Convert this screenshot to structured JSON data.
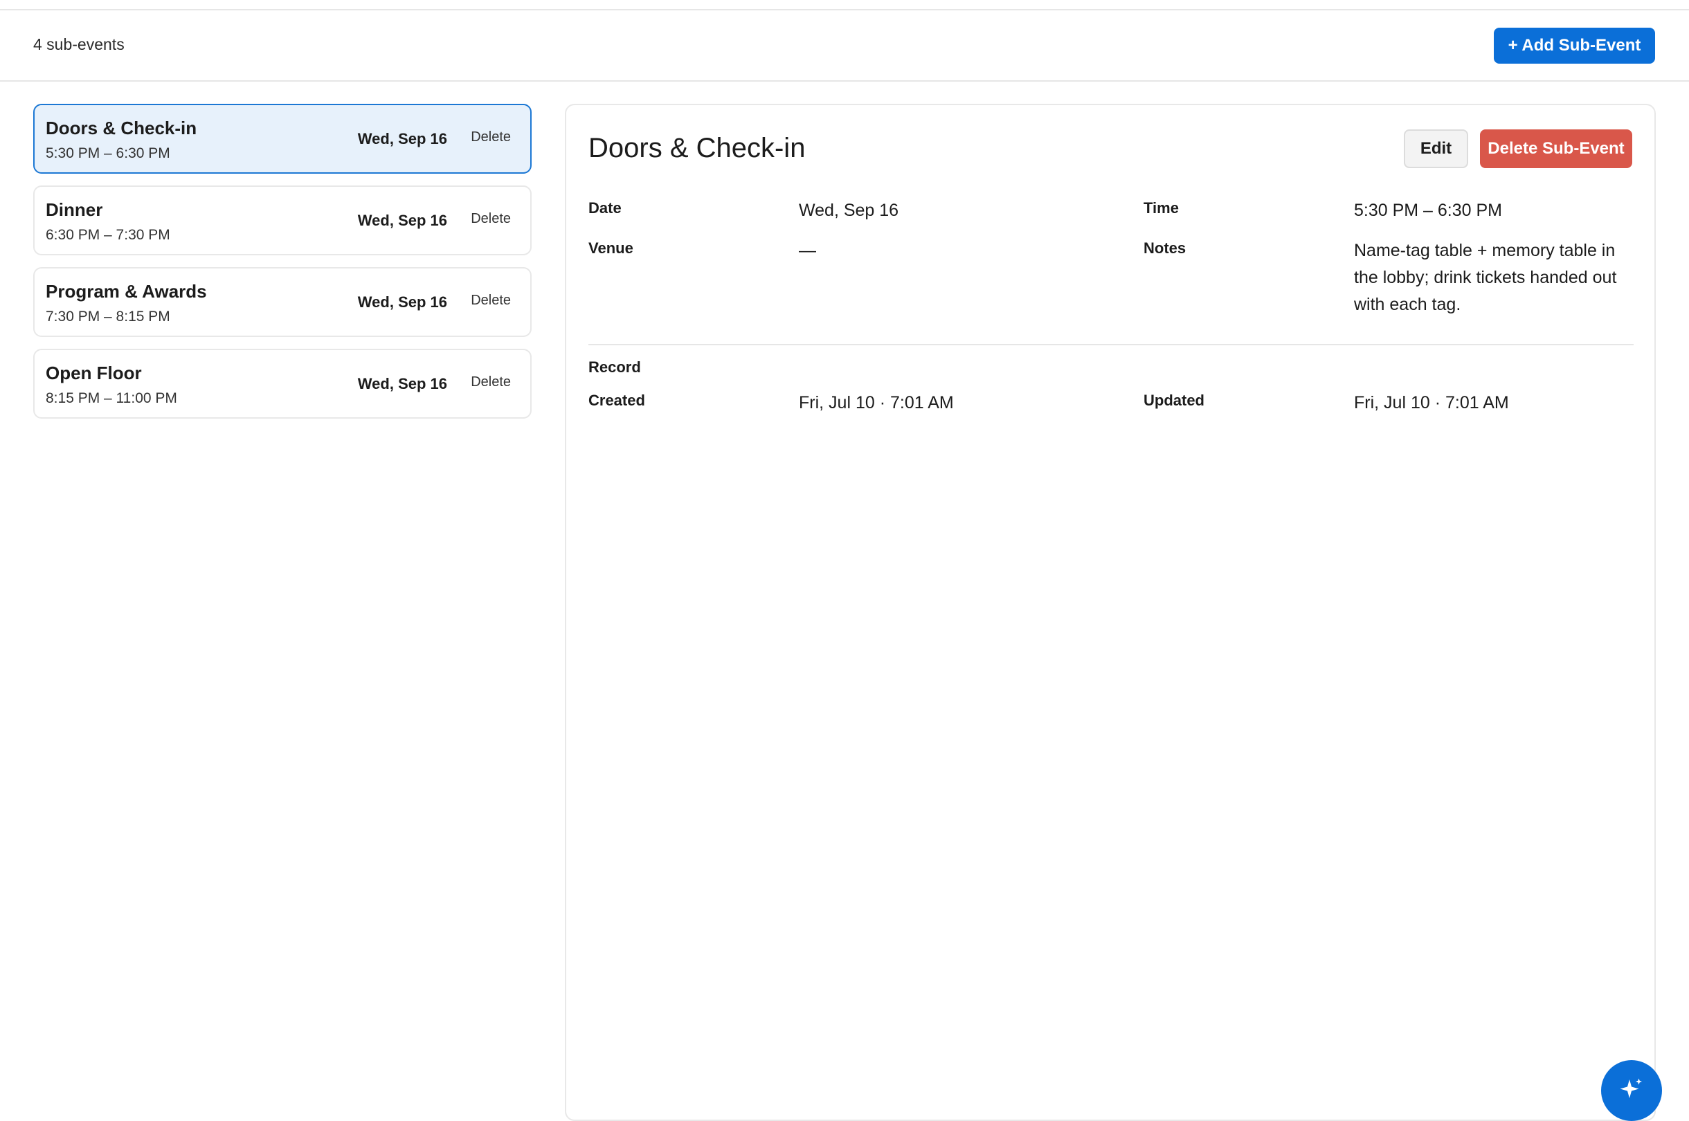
{
  "toolbar": {
    "count": "4 sub-events",
    "add_label": "+ Add Sub-Event"
  },
  "items": [
    {
      "name": "Doors & Check-in",
      "time": "5:30 PM – 6:30 PM",
      "date": "Wed, Sep 16",
      "delete": "Delete",
      "selected": true
    },
    {
      "name": "Dinner",
      "time": "6:30 PM – 7:30 PM",
      "date": "Wed, Sep 16",
      "delete": "Delete"
    },
    {
      "name": "Program & Awards",
      "time": "7:30 PM – 8:15 PM",
      "date": "Wed, Sep 16",
      "delete": "Delete"
    },
    {
      "name": "Open Floor",
      "time": "8:15 PM – 11:00 PM",
      "date": "Wed, Sep 16",
      "delete": "Delete"
    }
  ],
  "detail": {
    "title": "Doors & Check-in",
    "edit_label": "Edit",
    "delete_label": "Delete Sub-Event",
    "date_label": "Date",
    "date_value": "Wed, Sep 16",
    "time_label": "Time",
    "time_value": "5:30 PM – 6:30 PM",
    "venue_label": "Venue",
    "venue_value": "—",
    "notes_label": "Notes",
    "notes_value": "Name-tag table + memory table in the lobby; drink tickets handed out with each tag.",
    "record_label": "Record",
    "created_label": "Created",
    "created_value": "Fri, Jul 10 · 7:01 AM",
    "updated_label": "Updated",
    "updated_value": "Fri, Jul 10 · 7:01 AM"
  },
  "fab": {
    "icon": "sparkle-icon"
  },
  "colors": {
    "accent": "#0b6fd8",
    "danger": "#d9574a",
    "selected_bg": "#e7f1fb"
  }
}
